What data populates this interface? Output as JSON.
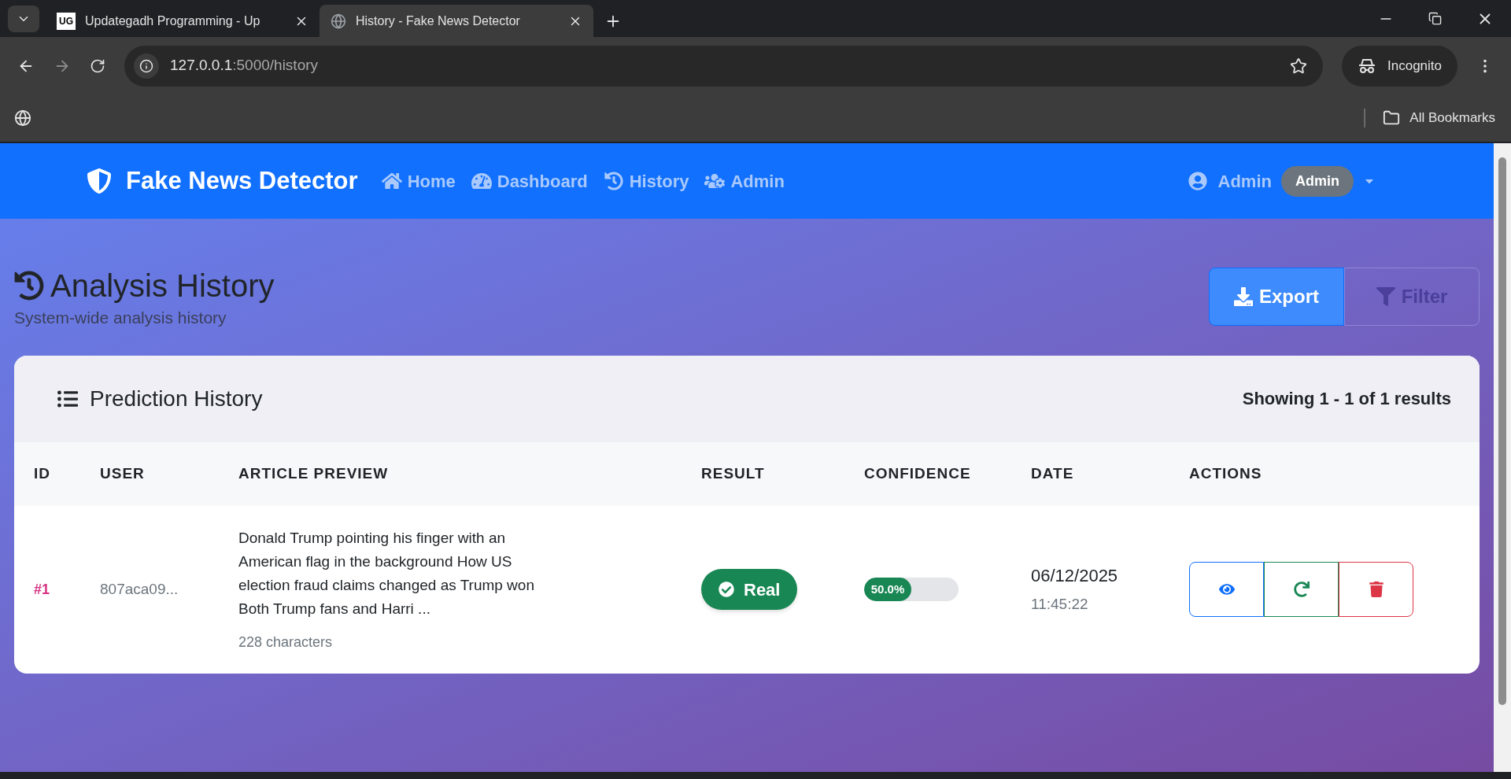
{
  "browser": {
    "tabs": [
      {
        "title": "Updategadh Programming - Up",
        "kind": "logo",
        "favicon_text": "UG",
        "selected": false
      },
      {
        "title": "History - Fake News Detector",
        "kind": "globe",
        "selected": true
      }
    ],
    "address": {
      "host": "127.0.0.1",
      "path": ":5000/history"
    },
    "profile": "Incognito",
    "bookmarks": "All Bookmarks"
  },
  "navbar": {
    "brand": "Fake News Detector",
    "links": [
      {
        "label": "Home",
        "kind": "home"
      },
      {
        "label": "Dashboard",
        "kind": "gauge"
      },
      {
        "label": "History",
        "kind": "history"
      },
      {
        "label": "Admin",
        "kind": "users"
      }
    ],
    "user": "Admin",
    "role": "Admin"
  },
  "header": {
    "title": "Analysis History",
    "subtitle": "System-wide analysis history",
    "buttons": [
      {
        "label": "Export",
        "kind": "download",
        "disabled": false
      },
      {
        "label": "Filter",
        "kind": "filter",
        "disabled": true
      }
    ]
  },
  "card": {
    "title": "Prediction History",
    "summary": "Showing 1 - 1 of 1 results",
    "columns": [
      "ID",
      "USER",
      "ARTICLE PREVIEW",
      "RESULT",
      "CONFIDENCE",
      "DATE",
      "ACTIONS"
    ],
    "rows": [
      {
        "id": "#1",
        "user": "807aca09...",
        "preview": "Donald Trump pointing his finger with an American flag in the background How US election fraud claims changed as Trump won Both Trump fans and Harri ...",
        "length": "228 characters",
        "result": {
          "label": "Real",
          "kind": "real"
        },
        "confidence": {
          "level": 0.5,
          "text": "50.0%"
        },
        "date": "06/12/2025",
        "time": "11:45:22",
        "actions": [
          {
            "kind": "view"
          },
          {
            "kind": "reanalyze"
          },
          {
            "kind": "delete"
          }
        ]
      }
    ]
  }
}
